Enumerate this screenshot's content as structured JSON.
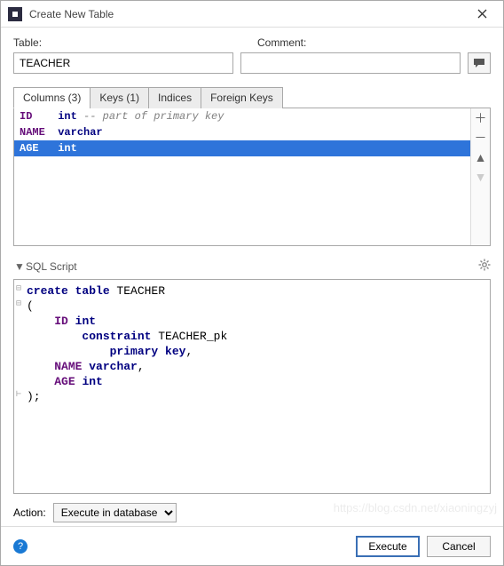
{
  "window": {
    "title": "Create New Table"
  },
  "labels": {
    "table": "Table:",
    "comment": "Comment:",
    "action": "Action:",
    "sqlScript": "SQL Script"
  },
  "fields": {
    "tableName": "TEACHER",
    "commentValue": ""
  },
  "tabs": [
    {
      "label": "Columns (3)",
      "active": true
    },
    {
      "label": "Keys (1)",
      "active": false
    },
    {
      "label": "Indices",
      "active": false
    },
    {
      "label": "Foreign Keys",
      "active": false
    }
  ],
  "columns": [
    {
      "name": "ID",
      "type": "int",
      "note": "-- part of primary key",
      "selected": false
    },
    {
      "name": "NAME",
      "type": "varchar",
      "note": "",
      "selected": false
    },
    {
      "name": "AGE",
      "type": "int",
      "note": "",
      "selected": true
    }
  ],
  "script": {
    "lines": [
      {
        "t": "kw",
        "text": "create table",
        "after": " TEACHER"
      },
      {
        "t": "plain",
        "text": "("
      },
      {
        "t": "col",
        "name": "ID",
        "type": "int"
      },
      {
        "t": "kw2",
        "text": "constraint",
        "after": " TEACHER_pk",
        "indent": 8
      },
      {
        "t": "kw2",
        "text": "primary key",
        "after": ",",
        "indent": 12
      },
      {
        "t": "col",
        "name": "NAME",
        "type": "varchar",
        "trail": ","
      },
      {
        "t": "col",
        "name": "AGE",
        "type": "int"
      },
      {
        "t": "plain",
        "text": ");"
      }
    ]
  },
  "action": {
    "options": [
      "Execute in database"
    ],
    "selected": "Execute in database"
  },
  "buttons": {
    "execute": "Execute",
    "cancel": "Cancel"
  },
  "watermark": "https://blog.csdn.net/xiaoningzyj"
}
